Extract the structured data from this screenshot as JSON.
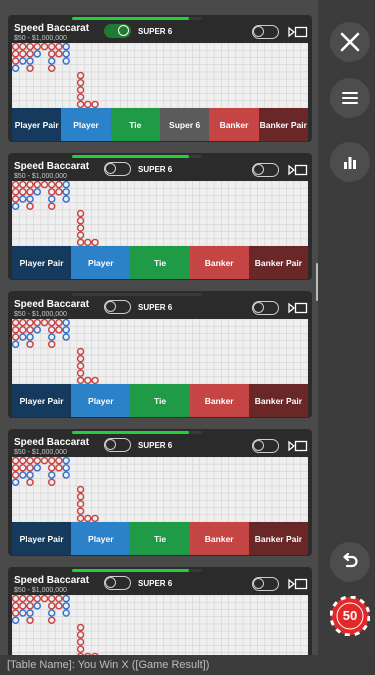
{
  "tables": [
    {
      "name": "Speed Baccarat",
      "limits": "$50 - $1,000,000",
      "super6_label": "SUPER 6",
      "super6_on": true,
      "progress": 0.9,
      "bets": [
        {
          "label": "Player Pair",
          "color": "#153a5e"
        },
        {
          "label": "Player",
          "color": "#2b82c9"
        },
        {
          "label": "Tie",
          "color": "#1f9a47"
        },
        {
          "label": "Super 6",
          "color": "#5b5b5b"
        },
        {
          "label": "Banker",
          "color": "#c54545"
        },
        {
          "label": "Banker Pair",
          "color": "#6a2727"
        }
      ]
    },
    {
      "name": "Speed Baccarat",
      "limits": "$50 - $1,000,000",
      "super6_label": "SUPER 6",
      "super6_on": false,
      "progress": 0.9,
      "bets": [
        {
          "label": "Player Pair",
          "color": "#153a5e"
        },
        {
          "label": "Player",
          "color": "#2b82c9"
        },
        {
          "label": "Tie",
          "color": "#1f9a47"
        },
        {
          "label": "Banker",
          "color": "#c54545"
        },
        {
          "label": "Banker Pair",
          "color": "#6a2727"
        }
      ]
    },
    {
      "name": "Speed Baccarat",
      "limits": "$50 - $1,000,000",
      "super6_label": "SUPER 6",
      "super6_on": false,
      "progress": 0.0,
      "bets": [
        {
          "label": "Player Pair",
          "color": "#153a5e"
        },
        {
          "label": "Player",
          "color": "#2b82c9"
        },
        {
          "label": "Tie",
          "color": "#1f9a47"
        },
        {
          "label": "Banker",
          "color": "#c54545"
        },
        {
          "label": "Banker Pair",
          "color": "#6a2727"
        }
      ]
    },
    {
      "name": "Speed Baccarat",
      "limits": "$50 - $1,000,000",
      "super6_label": "SUPER 6",
      "super6_on": false,
      "progress": 0.9,
      "bets": [
        {
          "label": "Player Pair",
          "color": "#153a5e"
        },
        {
          "label": "Player",
          "color": "#2b82c9"
        },
        {
          "label": "Tie",
          "color": "#1f9a47"
        },
        {
          "label": "Banker",
          "color": "#c54545"
        },
        {
          "label": "Banker Pair",
          "color": "#6a2727"
        }
      ]
    },
    {
      "name": "Speed Baccarat",
      "limits": "$50 - $1,000,000",
      "super6_label": "SUPER 6",
      "super6_on": false,
      "progress": 0.9,
      "bets": []
    }
  ],
  "bead_road": [
    [
      "B",
      "B",
      "B",
      "P"
    ],
    [
      "B",
      "B",
      "P"
    ],
    [
      "B",
      "B",
      "P",
      "B"
    ],
    [
      "B",
      "P"
    ],
    [
      "B"
    ],
    [
      "B",
      "B",
      "P",
      "B"
    ],
    [
      "B",
      "B"
    ],
    [
      "P",
      "P",
      "P"
    ]
  ],
  "banker_tail": [
    "B",
    "B",
    "B",
    "B",
    "B"
  ],
  "tail_extra": [
    "B",
    "B"
  ],
  "sidebar": {
    "close": "close-icon",
    "menu": "menu-icon",
    "stats": "stats-icon",
    "undo": "undo-icon",
    "chip_value": "50",
    "chip_color": "#e02a2a"
  },
  "footer": "[Table Name]: You Win X ([Game Result])",
  "colors": {
    "banker": "#c94040",
    "player": "#2f6fd0",
    "toggle_on": "#1f7a33",
    "progress": "#22d13a"
  }
}
